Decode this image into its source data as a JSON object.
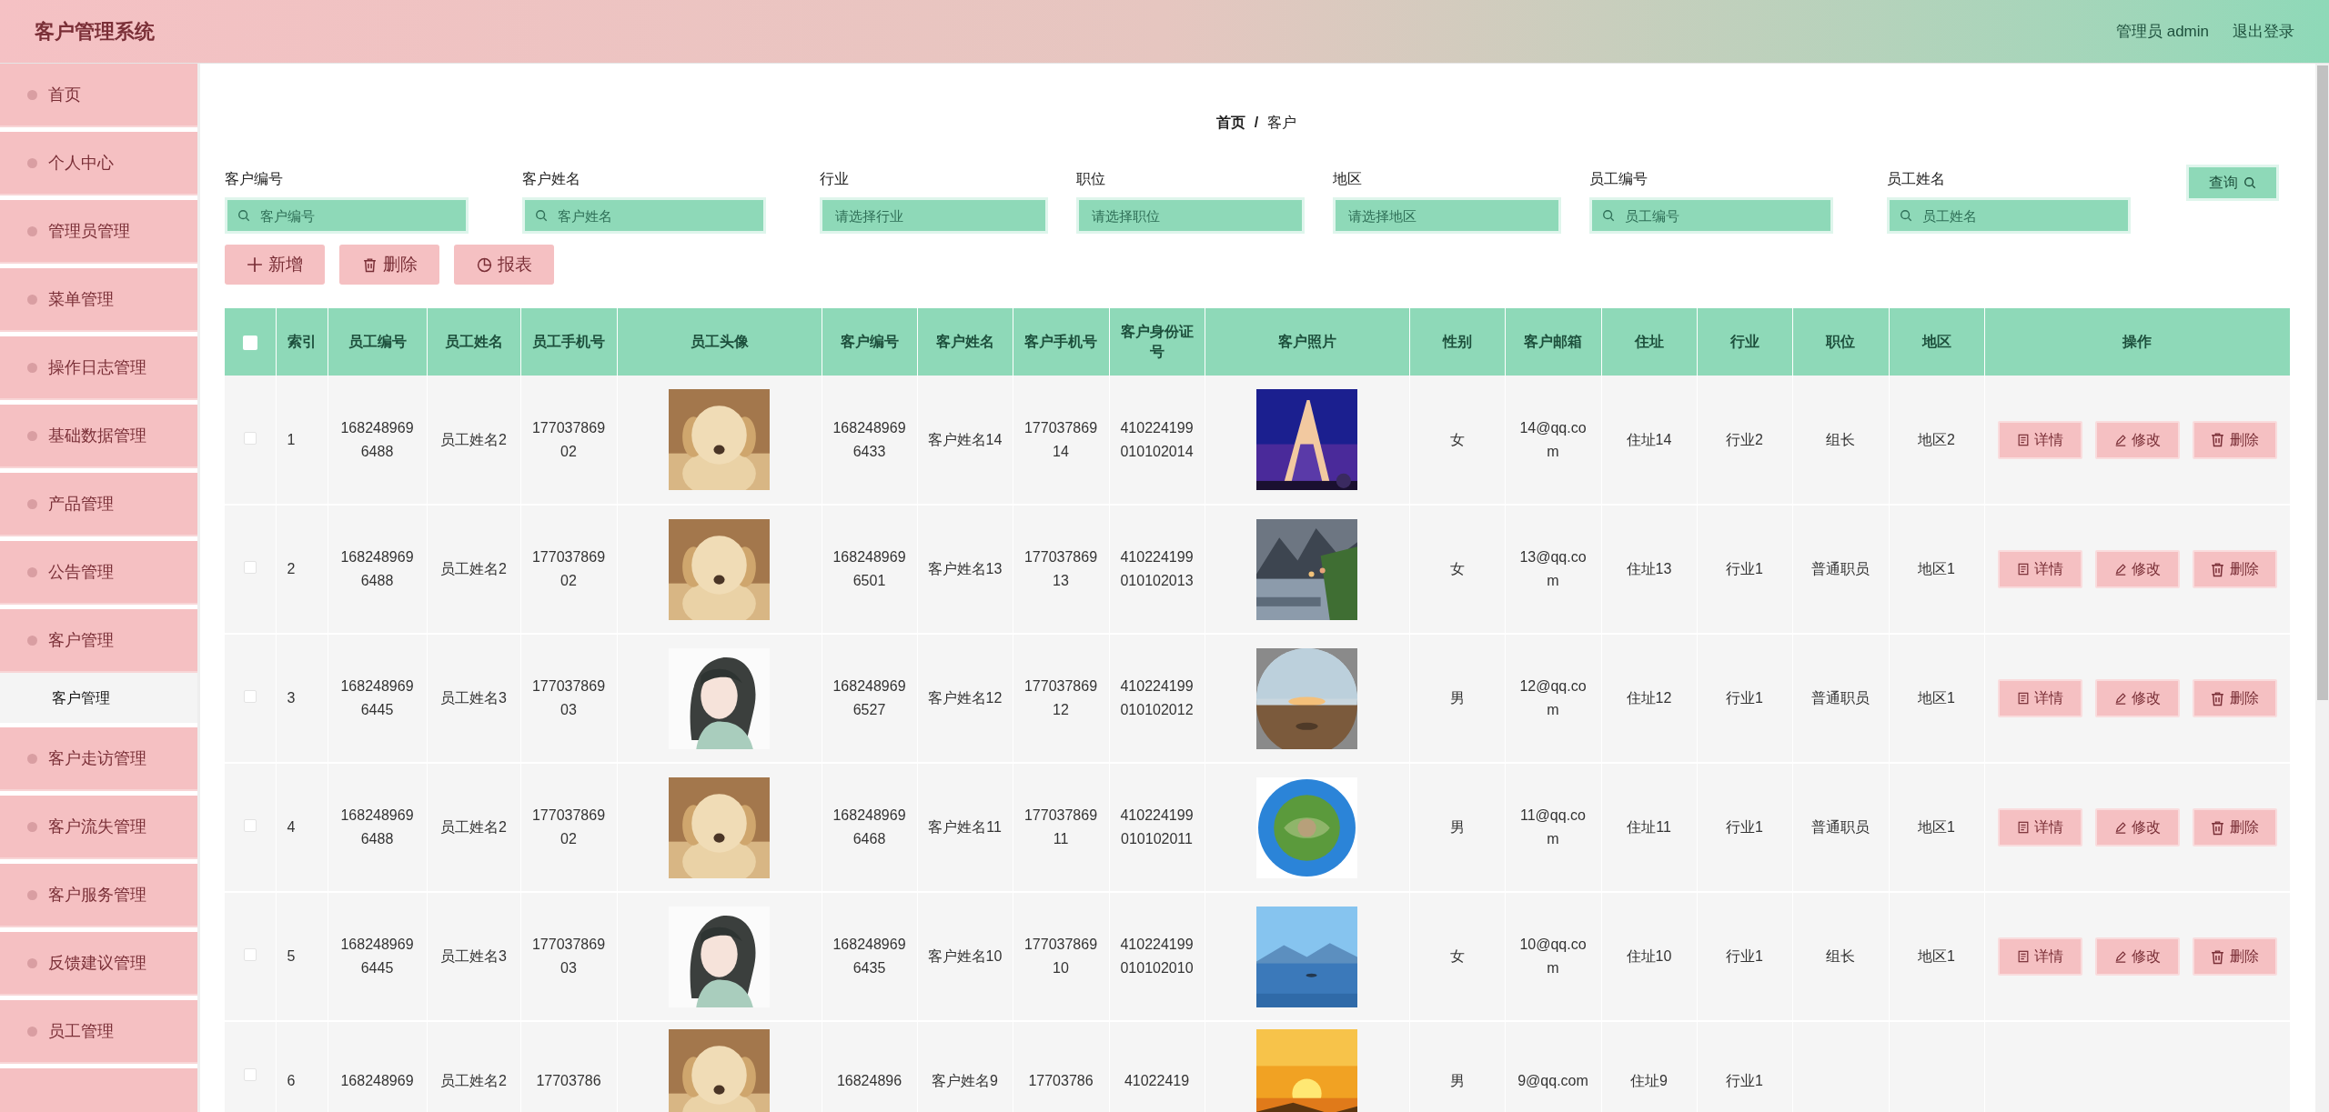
{
  "header": {
    "title": "客户管理系统",
    "user": "管理员 admin",
    "logout": "退出登录"
  },
  "sidebar": {
    "items": [
      {
        "label": "首页"
      },
      {
        "label": "个人中心"
      },
      {
        "label": "管理员管理"
      },
      {
        "label": "菜单管理"
      },
      {
        "label": "操作日志管理"
      },
      {
        "label": "基础数据管理"
      },
      {
        "label": "产品管理"
      },
      {
        "label": "公告管理"
      },
      {
        "label": "客户管理",
        "children": [
          {
            "label": "客户管理",
            "selected": true
          }
        ]
      },
      {
        "label": "客户走访管理"
      },
      {
        "label": "客户流失管理"
      },
      {
        "label": "客户服务管理"
      },
      {
        "label": "反馈建议管理"
      },
      {
        "label": "员工管理"
      }
    ]
  },
  "breadcrumb": {
    "items": [
      "首页",
      "客户"
    ],
    "separator": "/"
  },
  "filters": [
    {
      "label": "客户编号",
      "placeholder": "客户编号",
      "kind": "search"
    },
    {
      "label": "客户姓名",
      "placeholder": "客户姓名",
      "kind": "search"
    },
    {
      "label": "行业",
      "placeholder": "请选择行业",
      "kind": "select"
    },
    {
      "label": "职位",
      "placeholder": "请选择职位",
      "kind": "select"
    },
    {
      "label": "地区",
      "placeholder": "请选择地区",
      "kind": "select"
    },
    {
      "label": "员工编号",
      "placeholder": "员工编号",
      "kind": "search"
    },
    {
      "label": "员工姓名",
      "placeholder": "员工姓名",
      "kind": "search"
    }
  ],
  "search_button": "查询",
  "actions": [
    {
      "label": "新增",
      "kind": "add"
    },
    {
      "label": "删除",
      "kind": "delete"
    },
    {
      "label": "报表",
      "kind": "chart"
    }
  ],
  "table": {
    "select_all_checked": false,
    "columns": [
      "索引",
      "员工编号",
      "员工姓名",
      "员工手机号",
      "员工头像",
      "客户编号",
      "客户姓名",
      "客户手机号",
      "客户身份证号",
      "客户照片",
      "性别",
      "客户邮箱",
      "住址",
      "行业",
      "职位",
      "地区",
      "操作"
    ],
    "rows": [
      {
        "checked": false,
        "cells": [
          "1",
          "1682489696488",
          "员工姓名2",
          "17703786902",
          null,
          "1682489696433",
          "客户姓名14",
          "17703786914",
          "410224199010102014",
          null,
          "女",
          "14@qq.com",
          "住址14",
          "行业2",
          "组长",
          "地区2"
        ],
        "actions": [
          "详情",
          "修改",
          "删除"
        ]
      },
      {
        "checked": false,
        "cells": [
          "2",
          "1682489696488",
          "员工姓名2",
          "17703786902",
          null,
          "1682489696501",
          "客户姓名13",
          "17703786913",
          "410224199010102013",
          null,
          "女",
          "13@qq.com",
          "住址13",
          "行业1",
          "普通职员",
          "地区1"
        ],
        "actions": [
          "详情",
          "修改",
          "删除"
        ]
      },
      {
        "checked": false,
        "cells": [
          "3",
          "1682489696445",
          "员工姓名3",
          "17703786903",
          null,
          "1682489696527",
          "客户姓名12",
          "17703786912",
          "410224199010102012",
          null,
          "男",
          "12@qq.com",
          "住址12",
          "行业1",
          "普通职员",
          "地区1"
        ],
        "actions": [
          "详情",
          "修改",
          "删除"
        ]
      },
      {
        "checked": false,
        "cells": [
          "4",
          "1682489696488",
          "员工姓名2",
          "17703786902",
          null,
          "1682489696468",
          "客户姓名11",
          "17703786911",
          "410224199010102011",
          null,
          "男",
          "11@qq.com",
          "住址11",
          "行业1",
          "普通职员",
          "地区1"
        ],
        "actions": [
          "详情",
          "修改",
          "删除"
        ]
      },
      {
        "checked": false,
        "cells": [
          "5",
          "1682489696445",
          "员工姓名3",
          "17703786903",
          null,
          "1682489696435",
          "客户姓名10",
          "17703786910",
          "410224199010102010",
          null,
          "女",
          "10@qq.com",
          "住址10",
          "行业1",
          "组长",
          "地区1"
        ],
        "actions": [
          "详情",
          "修改",
          "删除"
        ]
      },
      {
        "checked": false,
        "cells": [
          "6",
          "168248969",
          "员工姓名2",
          "17703786",
          null,
          "16824896",
          "客户姓名9",
          "17703786",
          "41022419",
          null,
          "男",
          "9@qq.com",
          "住址9",
          "行业1"
        ]
      }
    ]
  }
}
